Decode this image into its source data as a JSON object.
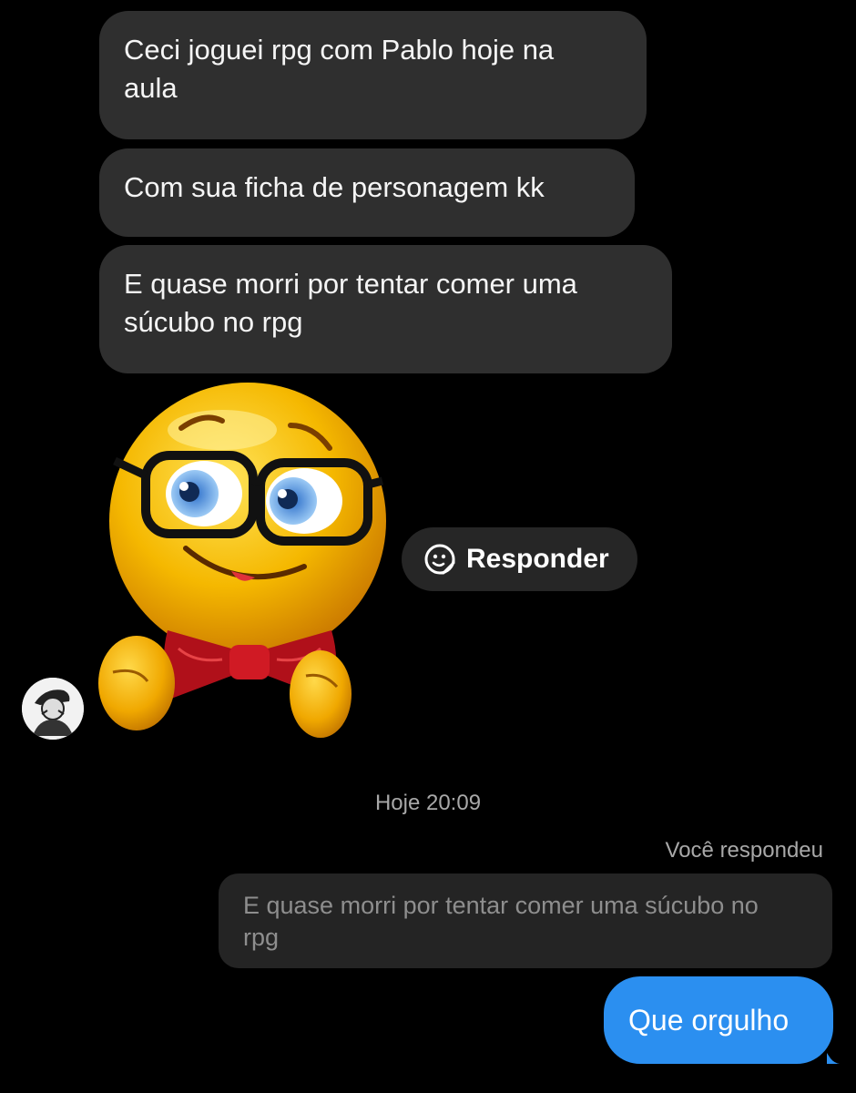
{
  "messages": {
    "incoming": [
      {
        "line1": "Ceci joguei rpg com Pablo hoje na",
        "line2": "aula"
      },
      {
        "line1": "Com sua ficha de personagem kk"
      },
      {
        "line1": "E quase morri por tentar comer uma",
        "line2": "súcubo no rpg"
      }
    ]
  },
  "sticker": {
    "icon": "nerd-emoji-sticker"
  },
  "avatar": {
    "icon": "user-avatar"
  },
  "reply": {
    "label": "Responder",
    "icon": "sticker-reply-icon"
  },
  "timestamp": "Hoje 20:09",
  "you_replied": "Você respondeu",
  "quoted": {
    "line1": "E quase morri por tentar comer uma súcubo no",
    "line2": "rpg"
  },
  "sent": {
    "text": "Que orgulho"
  },
  "colors": {
    "background": "#000000",
    "incoming_bubble": "#2f2f2f",
    "sent_bubble": "#2b8ff0",
    "quoted_bubble": "#242424",
    "muted_text": "#a8a8a8"
  }
}
